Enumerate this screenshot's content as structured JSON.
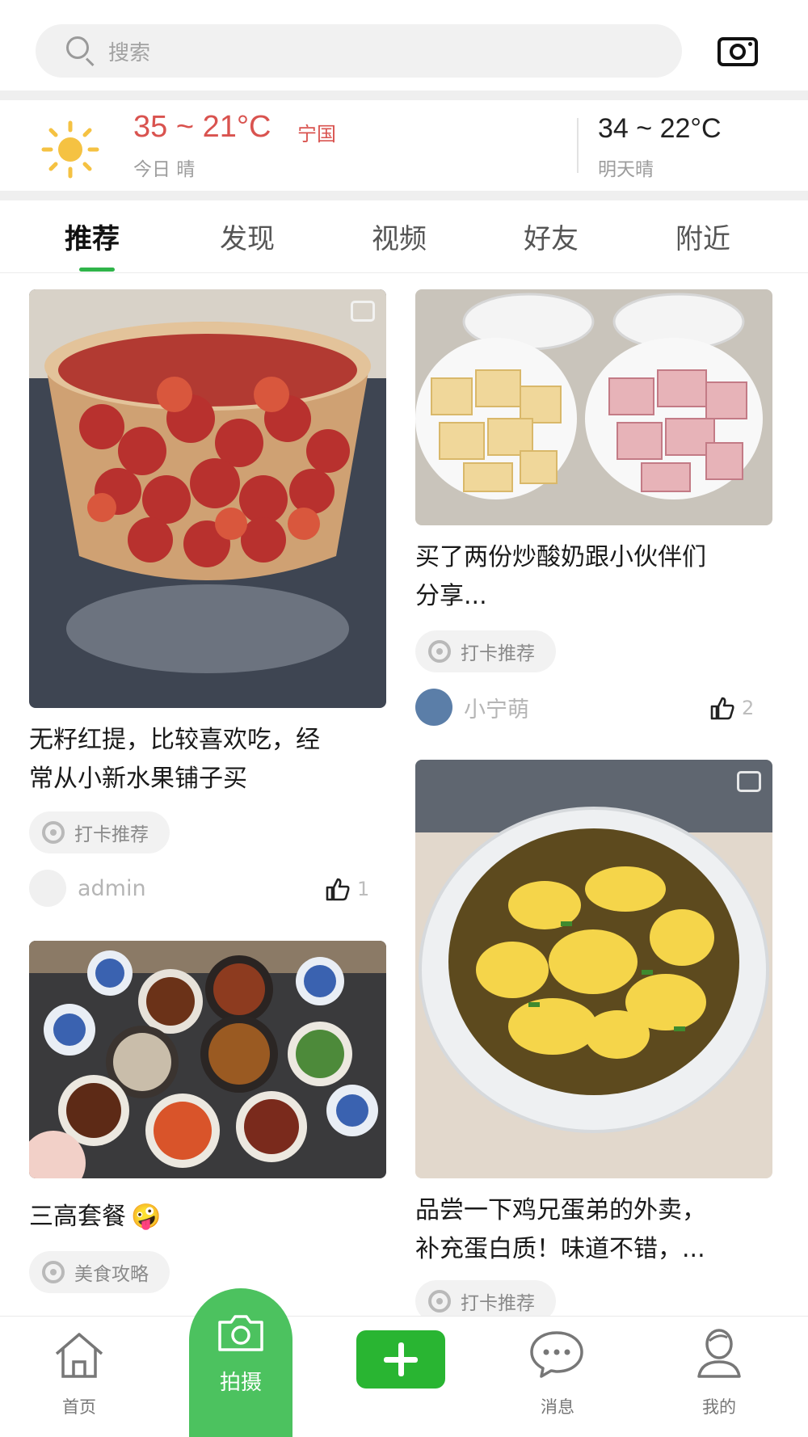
{
  "search": {
    "placeholder": "搜索"
  },
  "weather": {
    "today_temp": "35 ~ 21°C",
    "city": "宁国",
    "today_label": "今日 晴",
    "tomorrow_temp": "34 ~ 22°C",
    "tomorrow_label": "明天晴"
  },
  "tabs": [
    {
      "label": "推荐",
      "active": true
    },
    {
      "label": "发现"
    },
    {
      "label": "视频"
    },
    {
      "label": "好友"
    },
    {
      "label": "附近"
    }
  ],
  "feed": {
    "left": [
      {
        "title_line1": "无籽红提，比较喜欢吃，经",
        "title_line2": "常从小新水果铺子买",
        "tag": "打卡推荐",
        "author": "admin",
        "likes": "1"
      },
      {
        "title": "三高套餐",
        "emoji": "🤪",
        "tag": "美食攻略"
      }
    ],
    "right": [
      {
        "title_line1": "买了两份炒酸奶跟小伙伴们",
        "title_line2": "分享...",
        "tag": "打卡推荐",
        "author": "小宁萌",
        "likes": "2"
      },
      {
        "title_line1": "品尝一下鸡兄蛋弟的外卖，",
        "title_line2": "补充蛋白质！味道不错，...",
        "tag": "打卡推荐"
      }
    ]
  },
  "bottom_nav": {
    "home": "首页",
    "shoot": "拍摄",
    "messages": "消息",
    "mine": "我的"
  },
  "colors": {
    "accent": "#2fb44a",
    "temp_today": "#d9534f",
    "shoot_bg": "#4cc25f",
    "add_bg": "#29b532"
  }
}
